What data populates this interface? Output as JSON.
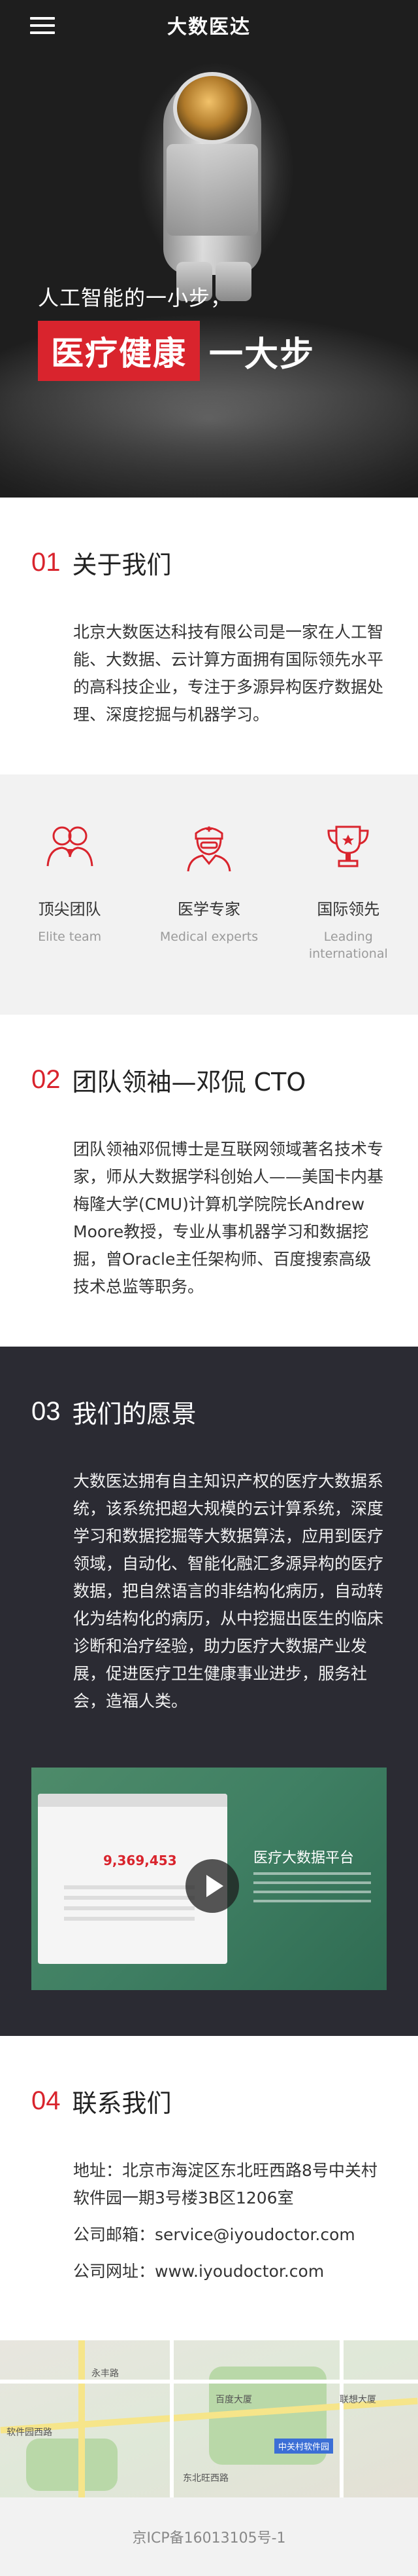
{
  "header": {
    "brand": "大数医达"
  },
  "hero": {
    "line1": "人工智能的一小步，",
    "highlight": "医疗健康",
    "rest": "一大步"
  },
  "about": {
    "num": "01",
    "title": "关于我们",
    "text": "北京大数医达科技有限公司是一家在人工智能、大数据、云计算方面拥有国际领先水平的高科技企业，专注于多源异构医疗数据处理、深度挖掘与机器学习。"
  },
  "features": [
    {
      "cn": "顶尖团队",
      "en": "Elite team",
      "icon": "team-icon"
    },
    {
      "cn": "医学专家",
      "en": "Medical experts",
      "icon": "doctor-icon"
    },
    {
      "cn": "国际领先",
      "en": "Leading international",
      "icon": "trophy-icon"
    }
  ],
  "team": {
    "num": "02",
    "title": "团队领袖—邓侃 CTO",
    "text": "团队领袖邓侃博士是互联网领域著名技术专家，师从大数据学科创始人——美国卡内基梅隆大学(CMU)计算机学院院长Andrew Moore教授，专业从事机器学习和数据挖掘，曾Oracle主任架构师、百度搜索高级技术总监等职务。"
  },
  "vision": {
    "num": "03",
    "title": "我们的愿景",
    "text": "大数医达拥有自主知识产权的医疗大数据系统，该系统把超大规模的云计算系统，深度学习和数据挖掘等大数据算法，应用到医疗领域，自动化、智能化融汇多源异构的医疗数据，把自然语言的非结构化病历，自动转化为结构化的病历，从中挖掘出医生的临床诊断和治疗经验，助力医疗大数据产业发展，促进医疗卫生健康事业进步，服务社会，造福人类。",
    "video": {
      "number": "9,369,453",
      "title": "医疗大数据平台"
    }
  },
  "contact": {
    "num": "04",
    "title": "联系我们",
    "address": "地址：北京市海淀区东北旺西路8号中关村软件园一期3号楼3B区1206室",
    "email": "公司邮箱：service@iyoudoctor.com",
    "site": "公司网址：www.iyoudoctor.com"
  },
  "map": {
    "labels": [
      "永丰路",
      "中关村软件园",
      "百度大厦",
      "联想大厦",
      "软件园西路",
      "东北旺西路"
    ]
  },
  "footer": {
    "icp": "京ICP备16013105号-1"
  },
  "colors": {
    "accent": "#d9242d",
    "dark": "#2b2b33"
  }
}
